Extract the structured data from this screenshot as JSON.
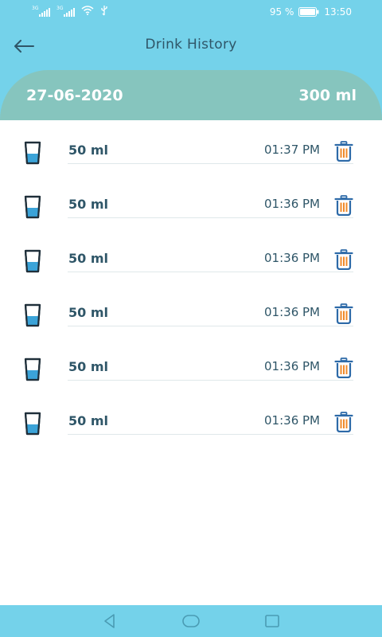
{
  "status_bar": {
    "sim1_tag": "3G",
    "sim2_tag": "3G",
    "battery_percent": "95 %",
    "time": "13:50",
    "icons": [
      "signal-icon",
      "signal-icon",
      "wifi-icon",
      "usb-icon",
      "battery-icon"
    ]
  },
  "header": {
    "title": "Drink History",
    "back_icon": "arrow-left-icon"
  },
  "summary": {
    "date": "27-06-2020",
    "total": "300 ml"
  },
  "entries": [
    {
      "amount": "50 ml",
      "time": "01:37 PM"
    },
    {
      "amount": "50 ml",
      "time": "01:36 PM"
    },
    {
      "amount": "50 ml",
      "time": "01:36 PM"
    },
    {
      "amount": "50 ml",
      "time": "01:36 PM"
    },
    {
      "amount": "50 ml",
      "time": "01:36 PM"
    },
    {
      "amount": "50 ml",
      "time": "01:36 PM"
    }
  ],
  "colors": {
    "primary": "#74d2ea",
    "summary_band": "#86c5be",
    "text": "#2f5668",
    "water": "#3ba3d8",
    "trash_outline": "#2d6aa8",
    "trash_bars": "#f08a2a"
  }
}
